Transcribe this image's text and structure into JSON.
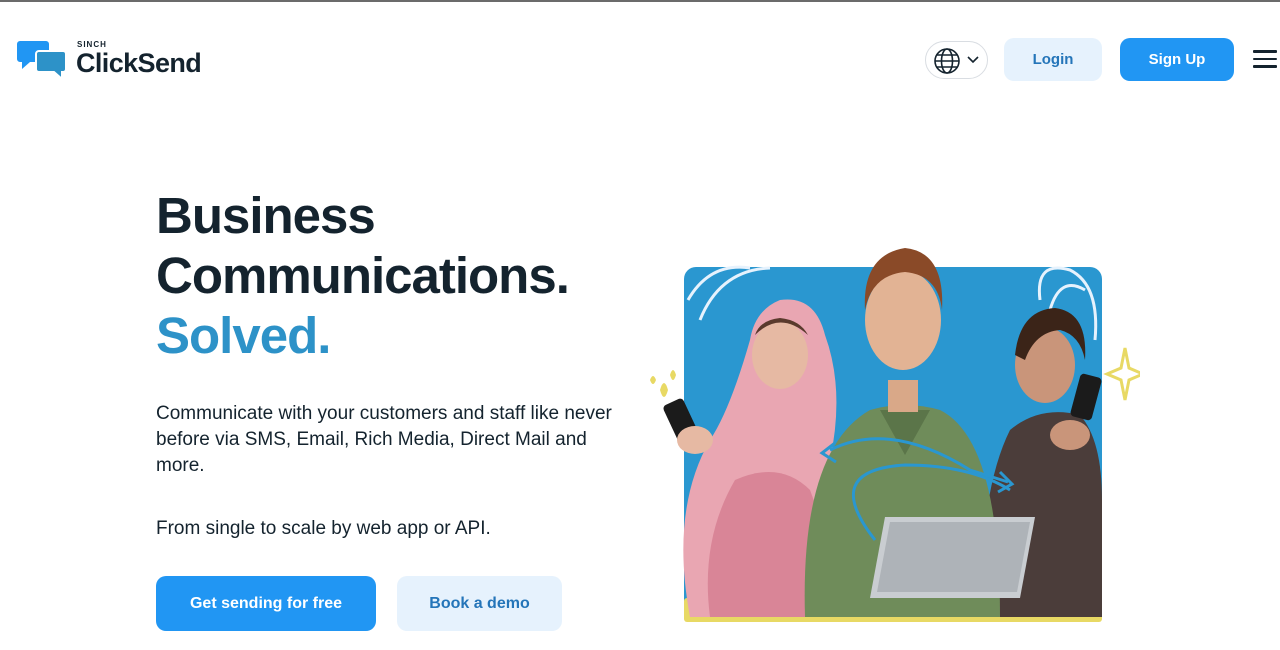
{
  "header": {
    "brand_small": "SINCH",
    "brand_name": "ClickSend",
    "language_icon": "globe-icon",
    "login_label": "Login",
    "signup_label": "Sign Up",
    "menu_icon": "hamburger-menu-icon"
  },
  "hero": {
    "title_line1": "Business",
    "title_line2": "Communications.",
    "title_line3": "Solved.",
    "description": "Communicate with your customers and staff like never before via SMS, Email, Rich Media, Direct Mail and more.",
    "subtext": "From single to scale by web app or API.",
    "primary_cta": "Get sending for free",
    "secondary_cta": "Book a demo"
  },
  "colors": {
    "primary": "#2196f3",
    "accent_text": "#2d92c8",
    "dark_text": "#14232e",
    "light_button_bg": "#e6f2fd",
    "image_panel": "#2a97d0",
    "image_strip": "#e8d964"
  }
}
